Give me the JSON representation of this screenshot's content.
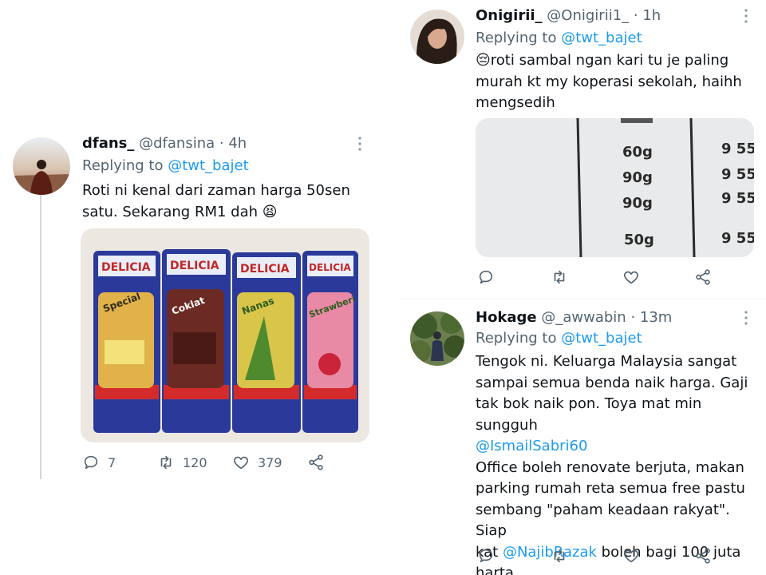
{
  "tweets": [
    {
      "name": "dfans_",
      "handle": "@dfansina",
      "time": "· 4h",
      "replying_prefix": "Replying to",
      "replying_to": "@twt_bajet",
      "lines": [
        "Roti ni kenal dari zaman harga 50sen",
        "satu. Sekarang RM1 dah"
      ],
      "emoji": "😫",
      "replies": "7",
      "retweets": "120",
      "likes": "379",
      "media": {
        "wrapper_labels": [
          "DELICIA",
          "DELICIA",
          "DELICIA",
          "DELICIA"
        ],
        "flavor_labels": [
          "Special",
          "Coklat",
          "Nanas",
          "Strawberi"
        ]
      }
    },
    {
      "name": "Onigirii_",
      "handle": "@Onigirii1_",
      "time": "· 1h",
      "replying_prefix": "Replying to",
      "replying_to": "@twt_bajet",
      "emoji": "😔",
      "lines": [
        "roti sambal ngan kari tu je paling",
        "murah kt my koperasi sekolah, haihh",
        "mengsedih"
      ],
      "media": {
        "weights": [
          "60g",
          "90g",
          "90g",
          "50g"
        ],
        "prices": [
          "9 55",
          "9 55",
          "9 55",
          "9 55"
        ]
      }
    },
    {
      "name": "Hokage",
      "handle": "@_awwabin",
      "time": "· 13m",
      "replying_prefix": "Replying to",
      "replying_to": "@twt_bajet",
      "line1": "Tengok ni. Keluarga Malaysia sangat",
      "line2": "sampai semua benda naik harga. Gaji",
      "line3": "tak bok naik pon. Toya mat min sungguh",
      "mention1": "@IsmailSabri60",
      "line5": "Office boleh renovate berjuta, makan",
      "line6": "parking rumah reta semua free pastu",
      "line7": "sembang \"paham keadaan rakyat\". Siap",
      "line8_pre": "kat",
      "mention2": "@NajibRazak",
      "line8_post": "boleh bagi 100 juta",
      "line9": "harta."
    }
  ],
  "icons": {
    "reply": "reply-icon",
    "retweet": "retweet-icon",
    "like": "heart-icon",
    "share": "share-icon",
    "more": "more-icon"
  },
  "colors": {
    "link": "#1d9bf0",
    "muted": "#536471",
    "text": "#0f1419"
  }
}
